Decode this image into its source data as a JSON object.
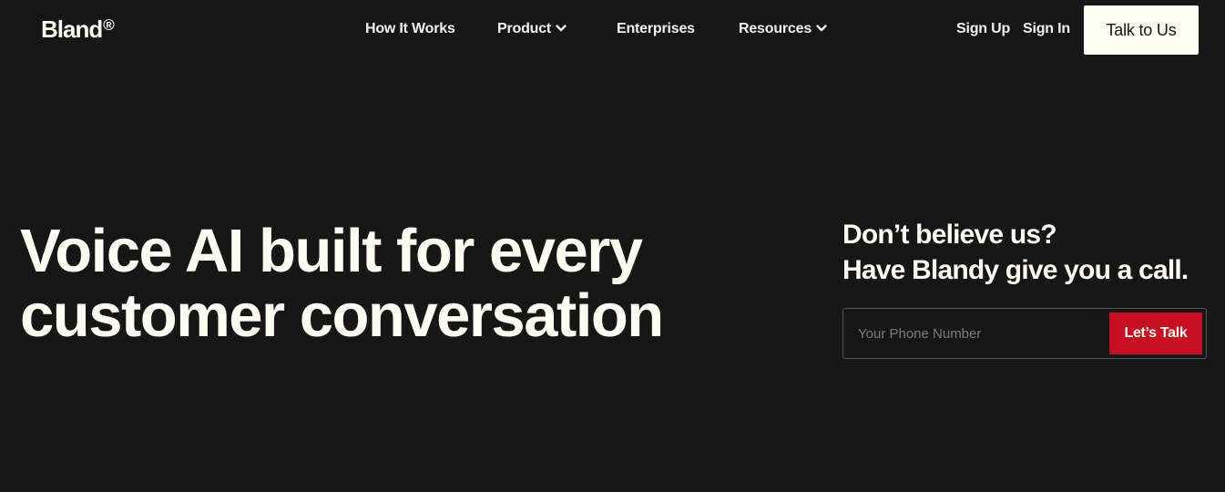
{
  "brand": {
    "name": "Bland",
    "mark": "®"
  },
  "nav": {
    "items": [
      {
        "label": "How It Works",
        "has_dropdown": false
      },
      {
        "label": "Product",
        "has_dropdown": true
      },
      {
        "label": "Enterprises",
        "has_dropdown": false
      },
      {
        "label": "Resources",
        "has_dropdown": true
      }
    ],
    "sign_up": "Sign Up",
    "sign_in": "Sign In",
    "cta": "Talk to Us"
  },
  "hero": {
    "title_line1": "Voice AI built for every",
    "title_line2": "customer conversation"
  },
  "callout": {
    "line1": "Don’t believe us?",
    "line2": "Have Blandy give you a call.",
    "phone_placeholder": "Your Phone Number",
    "phone_value": "",
    "button": "Let’s Talk"
  },
  "colors": {
    "background": "#161616",
    "text": "#fffcf2",
    "accent_red": "#c80e22",
    "cta_bg": "#fffcf2"
  },
  "icons": {
    "dropdown": "chevron-down-icon"
  }
}
